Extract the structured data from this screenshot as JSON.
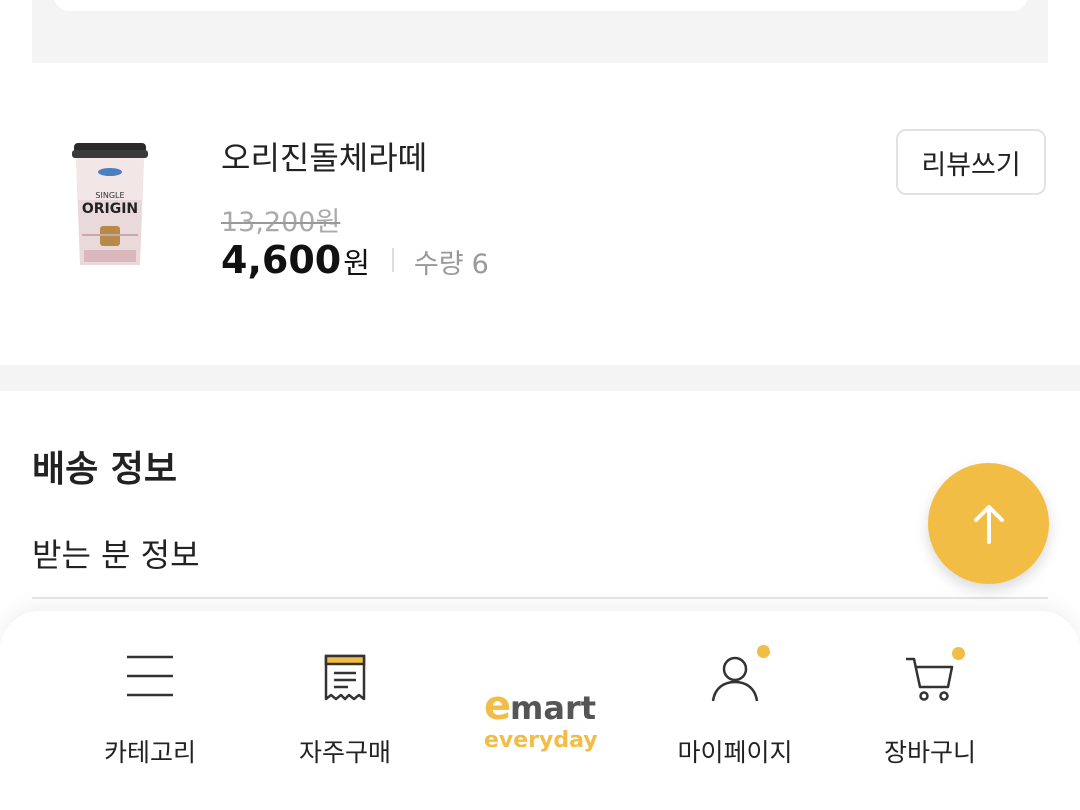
{
  "product": {
    "name": "오리진돌체라떼",
    "original_price": "13,200원",
    "price_value": "4,600",
    "price_unit": "원",
    "quantity_label": "수량",
    "quantity_value": "6",
    "review_button_label": "리뷰쓰기",
    "image_text": {
      "line1": "SINGLE",
      "line2": "ORIGIN"
    }
  },
  "shipping": {
    "section_title": "배송 정보",
    "recipient_title": "받는 분 정보"
  },
  "scroll_top_icon": "arrow-up-icon",
  "bottom_nav": {
    "items": [
      {
        "label": "카테고리",
        "icon": "menu-icon"
      },
      {
        "label": "자주구매",
        "icon": "receipt-icon"
      },
      {
        "label": "",
        "icon": "emart-everyday-logo"
      },
      {
        "label": "마이페이지",
        "icon": "user-icon",
        "has_dot": true
      },
      {
        "label": "장바구니",
        "icon": "cart-icon",
        "has_dot": true
      }
    ],
    "logo_text": {
      "top": "emart",
      "bottom": "everyday"
    }
  },
  "colors": {
    "accent": "#f2bd45",
    "background_band": "#f4f4f4",
    "text": "#222222",
    "muted": "#999999"
  }
}
